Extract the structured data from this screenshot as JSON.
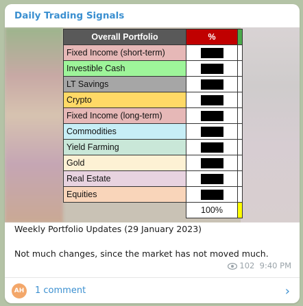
{
  "channel": {
    "name": "Daily Trading Signals"
  },
  "table": {
    "header_name": "Overall Portfolio",
    "header_pct": "%",
    "rows": [
      {
        "label": "Fixed Income (short-term)",
        "color": "#e6b8b7"
      },
      {
        "label": "Investible Cash",
        "color": "#9ef59a"
      },
      {
        "label": "LT Savings",
        "color": "#a6a6a6"
      },
      {
        "label": "Crypto",
        "color": "#ffd966"
      },
      {
        "label": "Fixed Income (long-term)",
        "color": "#e6b8b7"
      },
      {
        "label": "Commodities",
        "color": "#c7eef6"
      },
      {
        "label": "Yield Farming",
        "color": "#c9e7d8"
      },
      {
        "label": "Gold",
        "color": "#fdf1d4"
      },
      {
        "label": "Real Estate",
        "color": "#e8d3e0"
      },
      {
        "label": "Equities",
        "color": "#f9d5ba"
      }
    ],
    "total": "100%"
  },
  "message": {
    "line1": "Weekly Portfolio Updates (29 January 2023)",
    "line2": "Not much changes, since the market has not moved much.",
    "views": "102",
    "time": "9:40 PM"
  },
  "footer": {
    "avatar_initials": "AH",
    "comments_label": "1 comment"
  }
}
